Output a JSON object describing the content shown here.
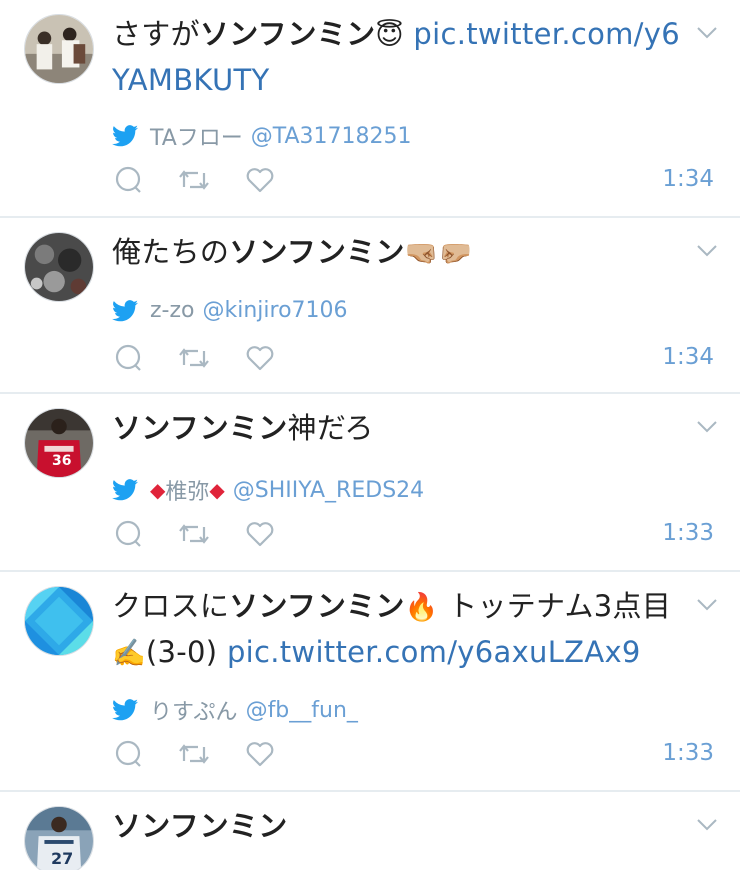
{
  "colors": {
    "accent": "#3573b5",
    "meta": "#8899a6",
    "divider": "#e6ecf0"
  },
  "tweets": [
    {
      "pre": "さすが",
      "hl": "ソンフンミン",
      "emoji": "😇",
      "post": " ",
      "link": "pic.twitter.com/y6YAMBKUTY",
      "author_name": "TAフロー",
      "author_handle": "@TA31718251",
      "time": "1:34",
      "avatar": "avatar-photo-men"
    },
    {
      "pre": "俺たちの",
      "hl": "ソンフンミン",
      "emoji": "🤜🏼🤛🏼",
      "post": "",
      "link": "",
      "author_name": "z-zo",
      "author_handle": "@kinjiro7106",
      "time": "1:34",
      "avatar": "avatar-photo-dark"
    },
    {
      "pre": "",
      "hl": "ソンフンミン",
      "emoji": "",
      "post": "神だろ",
      "link": "",
      "author_name": "椎弥",
      "author_handle": "@SHIIYA_REDS24",
      "diamond": "◆",
      "time": "1:33",
      "avatar": "avatar-photo-jersey-36"
    },
    {
      "pre": "クロスに",
      "hl": "ソンフンミン",
      "emoji": "🔥",
      "post": " トッテナム3点目",
      "emoji2": "✍️",
      "post2": "(3-0) ",
      "link": "pic.twitter.com/y6axuLZAx9",
      "author_name": "りすぷん",
      "author_handle": "@fb__fun_",
      "time": "1:33",
      "avatar": "avatar-blue-tiles"
    },
    {
      "pre": "",
      "hl": "ソンフンミン",
      "emoji": "",
      "post": "",
      "link": "",
      "author_name": "",
      "author_handle": "",
      "time": "",
      "avatar": "avatar-photo-jersey-27",
      "avatar_text": "27"
    }
  ]
}
